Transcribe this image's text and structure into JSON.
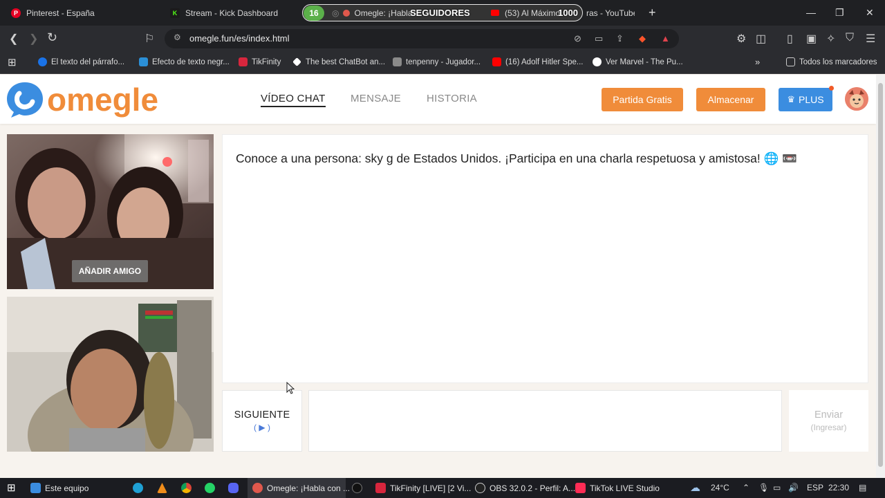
{
  "browser": {
    "tabs": [
      {
        "title": "Pinterest - España",
        "icon": "pinterest-icon",
        "color": "#e60023"
      },
      {
        "title": "Stream - Kick Dashboard",
        "icon": "kick-icon",
        "color": "#53fc18"
      },
      {
        "title": "Omegle: ¡Habla",
        "icon": "omegle-icon",
        "color": "#e0584c"
      },
      {
        "title": "(53) Al Máximo",
        "title_end": "ras - YouTube",
        "icon": "youtube-icon",
        "color": "#ff0000"
      }
    ],
    "followers_overlay": {
      "count": "16",
      "label": "SEGUIDORES",
      "goal": "1000"
    },
    "url": "omegle.fun/es/index.html",
    "bookmarks": [
      {
        "label": "El texto del párrafo...",
        "color": "#1a73e8"
      },
      {
        "label": "Efecto de texto negr...",
        "color": "#2b8fd6"
      },
      {
        "label": "TikFinity",
        "color": "#d7263d"
      },
      {
        "label": "The best ChatBot an...",
        "color": "#ffffff"
      },
      {
        "label": "tenpenny - Jugador...",
        "color": "#8a8a8a"
      },
      {
        "label": "(16) Adolf Hitler Spe...",
        "color": "#ff0000"
      },
      {
        "label": "Ver Marvel - The Pu...",
        "color": "#ffffff"
      }
    ],
    "all_bookmarks": "Todos los marcadores"
  },
  "site": {
    "logo": "omegle",
    "nav": [
      {
        "label": "VÍDEO CHAT",
        "active": true
      },
      {
        "label": "MENSAJE",
        "active": false
      },
      {
        "label": "HISTORIA",
        "active": false
      }
    ],
    "buttons": {
      "free_game": "Partida Gratis",
      "store": "Almacenar",
      "plus": "PLUS"
    },
    "colors": {
      "brand": "#f08c3a",
      "plus": "#3b8de0"
    }
  },
  "video": {
    "add_friend": "AÑADIR AMIGO"
  },
  "chat": {
    "message": "Conoce a una persona: sky g de Estados Unidos. ¡Participa en una charla respetuosa y amistosa! 🌐 📼",
    "next_label": "SIGUIENTE",
    "next_hint": "( ▶ )",
    "input_value": "",
    "send_label": "Enviar",
    "send_hint": "(Ingresar)"
  },
  "taskbar": {
    "items": [
      {
        "label": "Este equipo",
        "color": "#3b8de0"
      },
      {
        "label": "Omegle: ¡Habla con ...",
        "color": "#e0584c"
      },
      {
        "label": "TikFinity [LIVE] [2 Vi...",
        "color": "#d7263d"
      },
      {
        "label": "OBS 32.0.2 - Perfil: A...",
        "color": "#cccccc"
      },
      {
        "label": "TikTok LIVE Studio",
        "color": "#fe2c55"
      }
    ],
    "temperature": "24°C",
    "language": "ESP",
    "time": "22:30"
  }
}
